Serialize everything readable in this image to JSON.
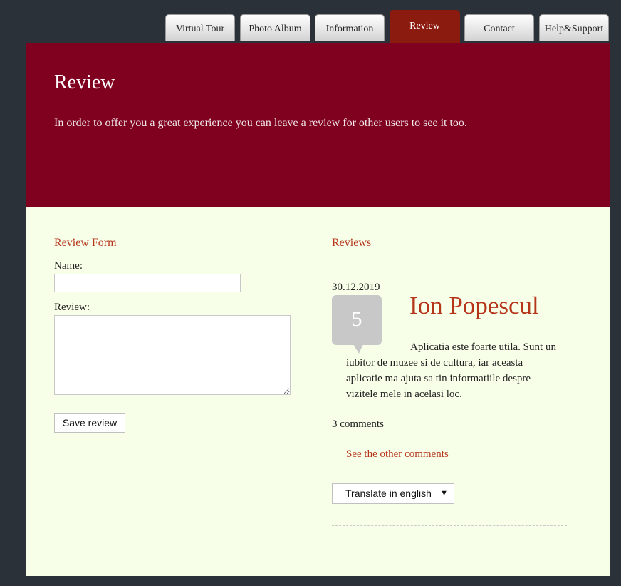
{
  "nav": {
    "tabs": [
      {
        "label": "Virtual Tour",
        "active": false
      },
      {
        "label": "Photo Album",
        "active": false
      },
      {
        "label": "Information",
        "active": false
      },
      {
        "label": "Review",
        "active": true
      },
      {
        "label": "Contact",
        "active": false
      },
      {
        "label": "Help&Support",
        "active": false
      }
    ]
  },
  "header": {
    "title": "Review",
    "subtitle": "In order to offer you a great experience you can leave a review for other users to see it too."
  },
  "form": {
    "title": "Review Form",
    "name_label": "Name:",
    "name_value": "",
    "review_label": "Review:",
    "review_value": "",
    "save_label": "Save review"
  },
  "reviews": {
    "title": "Reviews",
    "items": [
      {
        "date": "30.12.2019",
        "rating": "5",
        "author": "Ion Popescul",
        "text": "Aplicatia este foarte utila. Sunt un iubitor de muzee si de cultura, iar aceasta aplicatie ma ajuta sa tin informatiile despre vizitele mele in acelasi loc.",
        "comments_count": "3 comments",
        "other_comments_label": "See the other comments",
        "translate_selected": "Translate in english"
      }
    ]
  },
  "colors": {
    "background": "#2a3138",
    "header_bg": "#80001f",
    "content_bg": "#f7ffe8",
    "accent": "#b5351b",
    "active_tab": "#8b1a0f"
  }
}
